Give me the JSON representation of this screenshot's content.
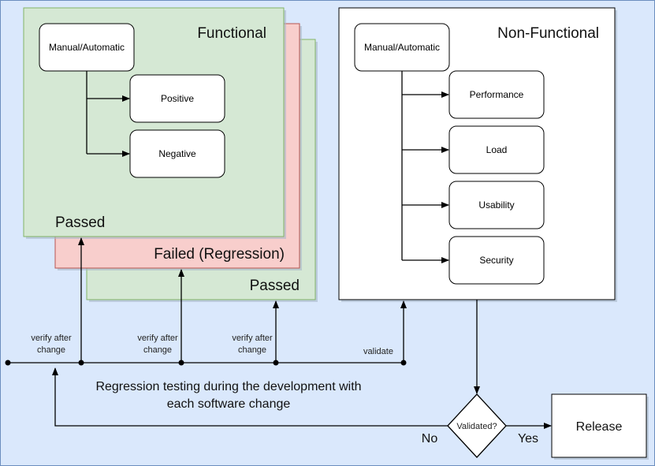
{
  "colors": {
    "background": "#dae8fc",
    "background_border": "#6c8ebf",
    "passed_fill": "#d5e8d4",
    "passed_border": "#82b366",
    "failed_fill": "#f8cecc",
    "failed_border": "#b85450"
  },
  "functional": {
    "title": "Functional",
    "method": "Manual/Automatic",
    "positive": "Positive",
    "negative": "Negative",
    "passed_front": "Passed",
    "failed": "Failed (Regression)",
    "passed_back": "Passed"
  },
  "non_functional": {
    "title": "Non-Functional",
    "method": "Manual/Automatic",
    "items": [
      "Performance",
      "Load",
      "Usability",
      "Security"
    ]
  },
  "timeline": {
    "verify1": [
      "verify after",
      "change"
    ],
    "verify2": [
      "verify after",
      "change"
    ],
    "verify3": [
      "verify after",
      "change"
    ],
    "validate": "validate",
    "caption": [
      "Regression testing during the development with",
      "each software change"
    ]
  },
  "decision": {
    "label": "Validated?",
    "no": "No",
    "yes": "Yes",
    "release": "Release"
  }
}
